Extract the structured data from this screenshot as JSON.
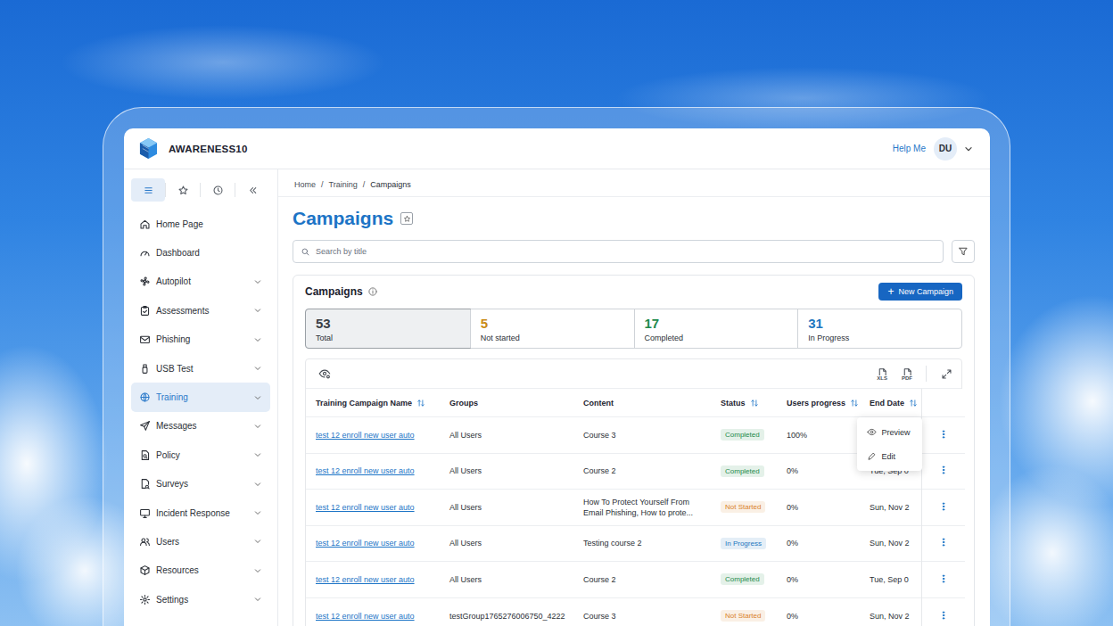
{
  "app": {
    "logo_text": "AWARENESS10",
    "help": "Help Me",
    "avatar": "DU"
  },
  "sidebar": {
    "toolbar": [
      {
        "selected": true
      },
      {
        "selected": false
      },
      {
        "selected": false
      },
      {
        "selected": false
      }
    ],
    "items": [
      {
        "label": "Home Page",
        "has_children": false,
        "selected": false
      },
      {
        "label": "Dashboard",
        "has_children": false,
        "selected": false
      },
      {
        "label": "Autopilot",
        "has_children": true,
        "selected": false
      },
      {
        "label": "Assessments",
        "has_children": true,
        "selected": false
      },
      {
        "label": "Phishing",
        "has_children": true,
        "selected": false
      },
      {
        "label": "USB Test",
        "has_children": true,
        "selected": false
      },
      {
        "label": "Training",
        "has_children": true,
        "selected": true
      },
      {
        "label": "Messages",
        "has_children": true,
        "selected": false
      },
      {
        "label": "Policy",
        "has_children": true,
        "selected": false
      },
      {
        "label": "Surveys",
        "has_children": true,
        "selected": false
      },
      {
        "label": "Incident Response",
        "has_children": true,
        "selected": false
      },
      {
        "label": "Users",
        "has_children": true,
        "selected": false
      },
      {
        "label": "Resources",
        "has_children": true,
        "selected": false
      },
      {
        "label": "Settings",
        "has_children": true,
        "selected": false
      }
    ]
  },
  "breadcrumb": {
    "separator": "/",
    "items": [
      "Home",
      "Training",
      "Campaigns"
    ]
  },
  "page": {
    "title": "Campaigns"
  },
  "search": {
    "placeholder": "Search by title"
  },
  "card": {
    "title": "Campaigns",
    "new_button": {
      "icon": "+",
      "label": "New Campaign"
    }
  },
  "stats": [
    {
      "value": "53",
      "label": "Total",
      "selected": true,
      "color": "#3a3f45"
    },
    {
      "value": "5",
      "label": "Not started",
      "selected": false,
      "color": "#c98a14"
    },
    {
      "value": "17",
      "label": "Completed",
      "selected": false,
      "color": "#1e8a4c"
    },
    {
      "value": "31",
      "label": "In Progress",
      "selected": false,
      "color": "#1f77c0"
    }
  ],
  "toolbar": {
    "exports": [
      "XLS",
      "PDF"
    ]
  },
  "table": {
    "columns": [
      {
        "label": "Training Campaign Name",
        "sortable": true
      },
      {
        "label": "Groups",
        "sortable": false
      },
      {
        "label": "Content",
        "sortable": false
      },
      {
        "label": "Status",
        "sortable": true
      },
      {
        "label": "Users progress",
        "sortable": true
      },
      {
        "label": "End Date",
        "sortable": true
      }
    ],
    "rows": [
      {
        "name": "test 12 enroll new user auto",
        "groups": "All Users",
        "content": [
          "Course 3"
        ],
        "status": {
          "label": "Completed",
          "color": "#1e8a4c"
        },
        "progress": "100%",
        "end_date": "",
        "menu_open": true
      },
      {
        "name": "test 12 enroll new user auto",
        "groups": "All Users",
        "content": [
          "Course 2"
        ],
        "status": {
          "label": "Completed",
          "color": "#1e8a4c"
        },
        "progress": "0%",
        "end_date": "Tue, Sep 0",
        "menu_open": false
      },
      {
        "name": "test 12 enroll new user auto",
        "groups": "All Users",
        "content": [
          "How To Protect Yourself From",
          "Email Phishing, How to prote..."
        ],
        "status": {
          "label": "Not Started",
          "color": "#d9822b"
        },
        "progress": "0%",
        "end_date": "Sun, Nov 2",
        "menu_open": false
      },
      {
        "name": "test 12 enroll new user auto",
        "groups": "All Users",
        "content": [
          "Testing course 2"
        ],
        "status": {
          "label": "In Progress",
          "color": "#1f77c0"
        },
        "progress": "0%",
        "end_date": "Sun, Nov 2",
        "menu_open": false
      },
      {
        "name": "test 12 enroll new user auto",
        "groups": "All Users",
        "content": [
          "Course 2"
        ],
        "status": {
          "label": "Completed",
          "color": "#1e8a4c"
        },
        "progress": "0%",
        "end_date": "Tue, Sep 0",
        "menu_open": false
      },
      {
        "name": "test 12 enroll new user auto",
        "groups": "testGroup1765276006750_4222",
        "content": [
          "Course 3"
        ],
        "status": {
          "label": "Not Started",
          "color": "#d9822b"
        },
        "progress": "0%",
        "end_date": "Sun, Nov 2",
        "menu_open": false
      }
    ]
  },
  "row_menu": {
    "items": [
      "Preview",
      "Edit"
    ]
  }
}
